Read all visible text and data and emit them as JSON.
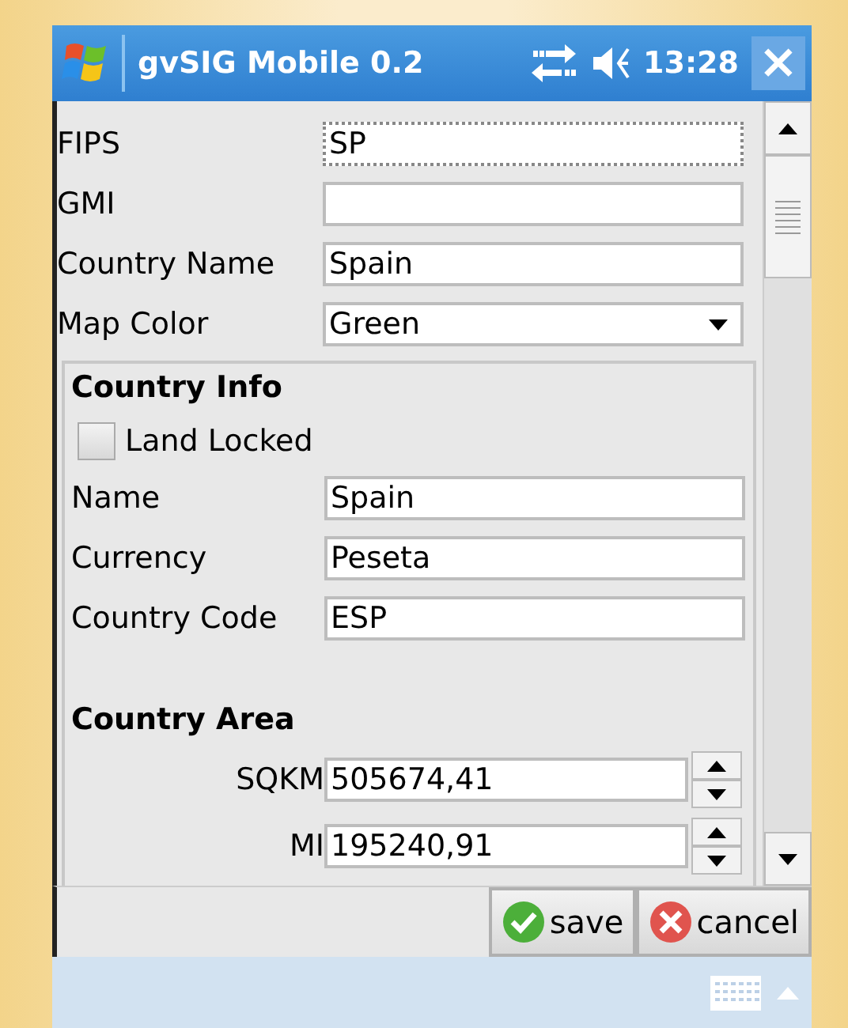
{
  "title_bar": {
    "title": "gvSIG Mobile 0.2",
    "time": "13:28",
    "close": "×"
  },
  "fields": [
    {
      "kind": "text",
      "label": "FIPS",
      "value": "SP",
      "focused": true
    },
    {
      "kind": "text",
      "label": "GMI",
      "focused": false
    },
    {
      "kind": "text",
      "label": "Country Name",
      "value": "Spain",
      "focused": false
    },
    {
      "kind": "select",
      "label": "Map Color",
      "value": "Green",
      "focused": false
    }
  ],
  "country_info": {
    "heading": "Country Info",
    "land_locked": {
      "label": "Land Locked",
      "checked": false
    },
    "fields": [
      {
        "label": "Name",
        "value": "Spain"
      },
      {
        "label": "Currency",
        "value": "Peseta"
      },
      {
        "label": "Country Code",
        "value": "ESP"
      }
    ]
  },
  "country_area": {
    "heading": "Country Area",
    "fields": [
      {
        "label": "SQKM",
        "value": "505674,41"
      },
      {
        "label": "MI",
        "value": "195240,91"
      }
    ]
  },
  "buttons": [
    {
      "kind": "save",
      "label": "save"
    },
    {
      "kind": "cancel",
      "label": "cancel"
    }
  ]
}
